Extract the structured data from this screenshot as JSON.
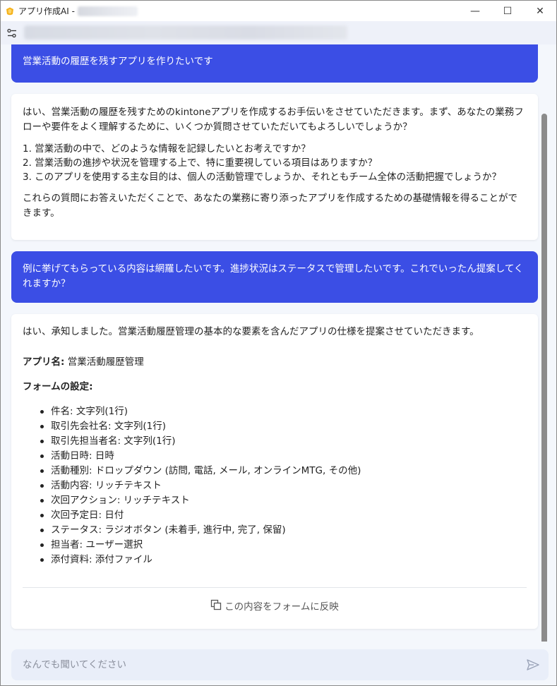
{
  "window": {
    "title": "アプリ作成AI -",
    "minimize_glyph": "—",
    "maximize_glyph": "☐",
    "close_glyph": "✕"
  },
  "messages": {
    "user1": "営業活動の履歴を残すアプリを作りたいです",
    "bot1": {
      "intro": "はい、営業活動の履歴を残すためのkintoneアプリを作成するお手伝いをさせていただきます。まず、あなたの業務フローや要件をよく理解するために、いくつか質問させていただいてもよろしいでしょうか？",
      "questions": [
        "1. 営業活動の中で、どのような情報を記録したいとお考えですか？",
        "2. 営業活動の進捗や状況を管理する上で、特に重要視している項目はありますか？",
        "3. このアプリを使用する主な目的は、個人の活動管理でしょうか、それともチーム全体の活動把握でしょうか？"
      ],
      "closing": "これらの質問にお答えいただくことで、あなたの業務に寄り添ったアプリを作成するための基礎情報を得ることができます。"
    },
    "user2": "例に挙げてもらっている内容は網羅したいです。進捗状況はステータスで管理したいです。これでいったん提案してくれますか？",
    "bot2": {
      "intro": "はい、承知しました。営業活動履歴管理の基本的な要素を含んだアプリの仕様を提案させていただきます。",
      "app_name_label": "アプリ名:",
      "app_name_value": "営業活動履歴管理",
      "form_settings_label": "フォームの設定:",
      "fields": [
        "件名: 文字列(1行)",
        "取引先会社名: 文字列(1行)",
        "取引先担当者名: 文字列(1行)",
        "活動日時: 日時",
        "活動種別: ドロップダウン (訪問, 電話, メール, オンラインMTG, その他)",
        "活動内容: リッチテキスト",
        "次回アクション: リッチテキスト",
        "次回予定日: 日付",
        "ステータス: ラジオボタン (未着手, 進行中, 完了, 保留)",
        "担当者: ユーザー選択",
        "添付資料: 添付ファイル"
      ],
      "reflect_button": "この内容をフォームに反映"
    }
  },
  "input": {
    "placeholder": "なんでも聞いてください"
  },
  "colors": {
    "user_bubble": "#3b4ee5",
    "background": "#f4f7fc",
    "app_icon": "#f5b21a"
  },
  "icons": [
    "app-logo-icon",
    "settings-tune-icon",
    "copy-icon",
    "send-icon"
  ]
}
